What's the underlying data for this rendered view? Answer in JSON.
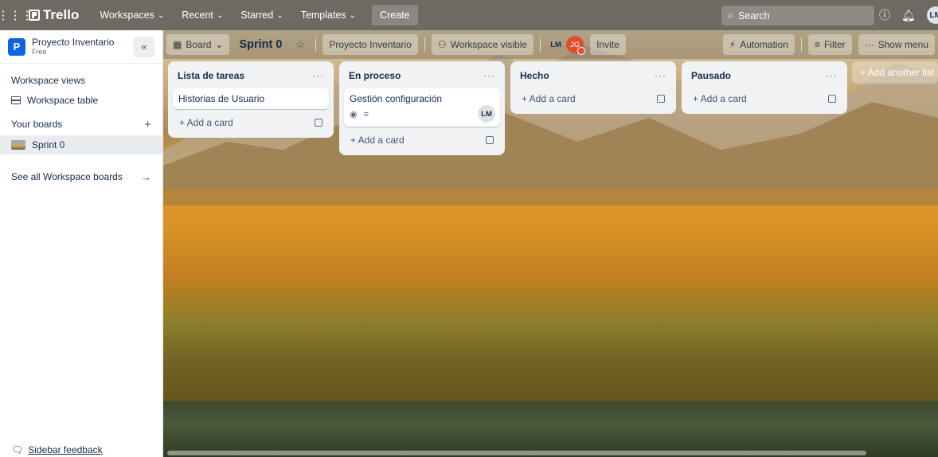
{
  "topnav": {
    "brand": "Trello",
    "menus": [
      {
        "label": "Workspaces"
      },
      {
        "label": "Recent"
      },
      {
        "label": "Starred"
      },
      {
        "label": "Templates"
      }
    ],
    "create": "Create",
    "search_placeholder": "Search",
    "user_initials": "LM"
  },
  "sidebar": {
    "workspace_initial": "P",
    "workspace_name": "Proyecto Inventario",
    "workspace_plan": "Free",
    "views_heading": "Workspace views",
    "workspace_table": "Workspace table",
    "your_boards": "Your boards",
    "boards": [
      {
        "label": "Sprint 0"
      }
    ],
    "see_all": "See all Workspace boards",
    "feedback": "Sidebar feedback"
  },
  "board_header": {
    "view": "Board",
    "title": "Sprint 0",
    "workspace": "Proyecto Inventario",
    "visibility": "Workspace visible",
    "members": [
      "LM",
      "JG"
    ],
    "invite": "Invite",
    "automation": "Automation",
    "filter": "Filter",
    "show_menu": "Show menu"
  },
  "lists": [
    {
      "title": "Lista de tareas",
      "cards": [
        {
          "title": "Historias de Usuario"
        }
      ],
      "add_card": "+ Add a card"
    },
    {
      "title": "En proceso",
      "cards": [
        {
          "title": "Gestión configuración",
          "member": "LM"
        }
      ],
      "add_card": "+ Add a card"
    },
    {
      "title": "Hecho",
      "cards": [],
      "add_card": "+ Add a card"
    },
    {
      "title": "Pausado",
      "cards": [],
      "add_card": "+ Add a card"
    }
  ],
  "add_another_list": "+ Add another list",
  "colors": {
    "topnav": "#6d6a62",
    "workspace_logo": "#0c66e4",
    "list_bg": "#f1f2f4",
    "member_jg": "#e04e2e"
  }
}
